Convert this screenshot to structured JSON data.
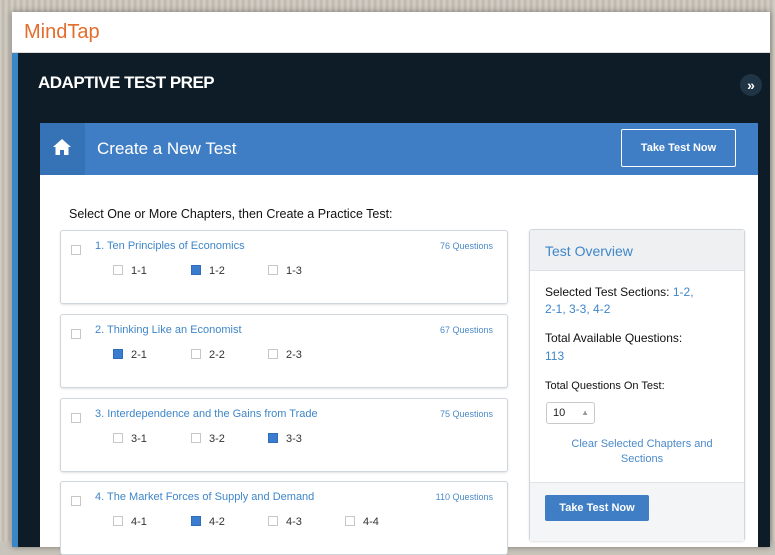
{
  "brand": "MindTap",
  "app_title": "ADAPTIVE TEST PREP",
  "panel": {
    "title": "Create a New Test",
    "take_test_label": "Take Test Now"
  },
  "instructions": "Select One or More Chapters, then Create a Practice Test:",
  "chapters": [
    {
      "title": "1. Ten Principles of Economics",
      "questions": "76 Questions",
      "checked": false,
      "sections": [
        {
          "label": "1-1",
          "checked": false
        },
        {
          "label": "1-2",
          "checked": true
        },
        {
          "label": "1-3",
          "checked": false
        }
      ]
    },
    {
      "title": "2. Thinking Like an Economist",
      "questions": "67 Questions",
      "checked": false,
      "sections": [
        {
          "label": "2-1",
          "checked": true
        },
        {
          "label": "2-2",
          "checked": false
        },
        {
          "label": "2-3",
          "checked": false
        }
      ]
    },
    {
      "title": "3. Interdependence and the Gains from Trade",
      "questions": "75 Questions",
      "checked": false,
      "sections": [
        {
          "label": "3-1",
          "checked": false
        },
        {
          "label": "3-2",
          "checked": false
        },
        {
          "label": "3-3",
          "checked": true
        }
      ]
    },
    {
      "title": "4. The Market Forces of Supply and Demand",
      "questions": "110 Questions",
      "checked": false,
      "sections": [
        {
          "label": "4-1",
          "checked": false
        },
        {
          "label": "4-2",
          "checked": true
        },
        {
          "label": "4-3",
          "checked": false
        },
        {
          "label": "4-4",
          "checked": false
        }
      ]
    }
  ],
  "overview": {
    "title": "Test Overview",
    "selected_label": "Selected Test Sections:",
    "selected_line1": "1-2,",
    "selected_line2": "2-1, 3-3, 4-2",
    "available_label": "Total Available Questions:",
    "available_value": "113",
    "on_test_label": "Total Questions On Test:",
    "on_test_value": "10",
    "clear_link": "Clear Selected Chapters and Sections",
    "take_test_label": "Take Test Now"
  },
  "colors": {
    "brand": "#e26d2c",
    "primary": "#3f7ec4",
    "link": "#3f86c9",
    "dark_bar": "#0d1c26"
  },
  "icons": {
    "home": "home-icon",
    "expand": "double-chevron-right-icon"
  }
}
